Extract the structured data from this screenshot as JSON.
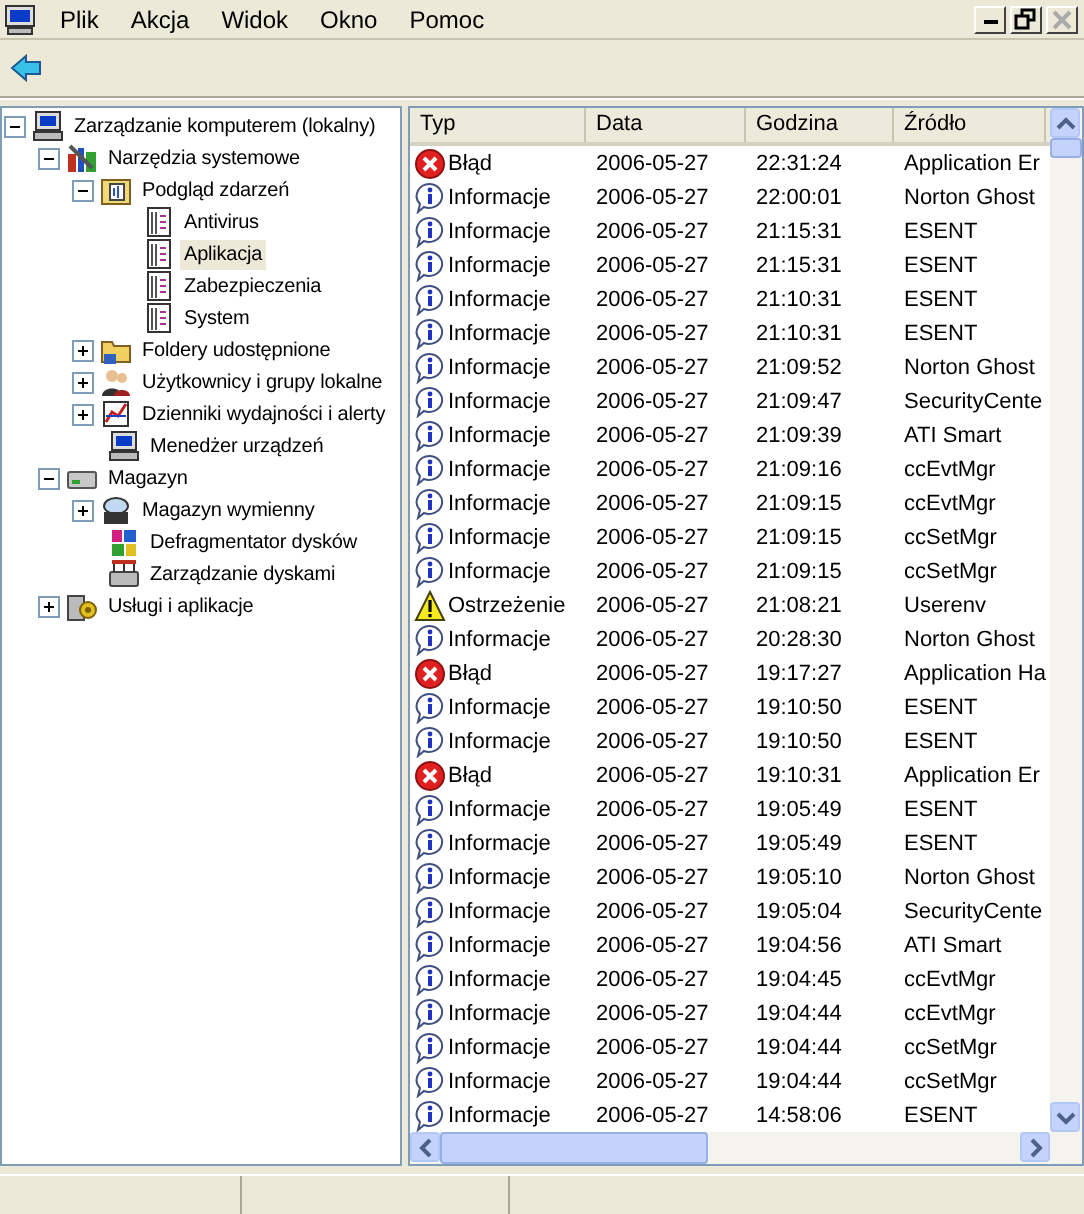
{
  "menu": [
    "Plik",
    "Akcja",
    "Widok",
    "Okno",
    "Pomoc"
  ],
  "tree": [
    {
      "label": "Zarządzanie komputerem (lokalny)",
      "kind": "computer",
      "expanded": true,
      "selected": false,
      "children": [
        {
          "label": "Narzędzia systemowe",
          "kind": "tools",
          "expanded": true,
          "selected": false,
          "children": [
            {
              "label": "Podgląd zdarzeń",
              "kind": "viewer",
              "expanded": true,
              "selected": false,
              "children": [
                {
                  "label": "Antivirus",
                  "kind": "log",
                  "selected": false
                },
                {
                  "label": "Aplikacja",
                  "kind": "log",
                  "selected": true
                },
                {
                  "label": "Zabezpieczenia",
                  "kind": "log",
                  "selected": false
                },
                {
                  "label": "System",
                  "kind": "log",
                  "selected": false
                }
              ]
            },
            {
              "label": "Foldery udostępnione",
              "kind": "folder",
              "expanded": false,
              "selected": false
            },
            {
              "label": "Użytkownicy i grupy lokalne",
              "kind": "users",
              "expanded": false,
              "selected": false
            },
            {
              "label": "Dzienniki wydajności i alerty",
              "kind": "chart",
              "expanded": false,
              "selected": false
            },
            {
              "label": "Menedżer urządzeń",
              "kind": "computer",
              "selected": false
            }
          ]
        },
        {
          "label": "Magazyn",
          "kind": "drive",
          "expanded": true,
          "selected": false,
          "children": [
            {
              "label": "Magazyn wymienny",
              "kind": "disc",
              "expanded": false,
              "selected": false
            },
            {
              "label": "Defragmentator dysków",
              "kind": "defrag",
              "selected": false
            },
            {
              "label": "Zarządzanie dyskami",
              "kind": "disk",
              "selected": false
            }
          ]
        },
        {
          "label": "Usługi i aplikacje",
          "kind": "services",
          "expanded": false,
          "selected": false
        }
      ]
    }
  ],
  "table": {
    "columns": [
      "Typ",
      "Data",
      "Godzina",
      "Źródło"
    ],
    "rows": [
      {
        "kind": "error",
        "type": "Błąd",
        "date": "2006-05-27",
        "time": "22:31:24",
        "source": "Application Er"
      },
      {
        "kind": "info",
        "type": "Informacje",
        "date": "2006-05-27",
        "time": "22:00:01",
        "source": "Norton Ghost"
      },
      {
        "kind": "info",
        "type": "Informacje",
        "date": "2006-05-27",
        "time": "21:15:31",
        "source": "ESENT"
      },
      {
        "kind": "info",
        "type": "Informacje",
        "date": "2006-05-27",
        "time": "21:15:31",
        "source": "ESENT"
      },
      {
        "kind": "info",
        "type": "Informacje",
        "date": "2006-05-27",
        "time": "21:10:31",
        "source": "ESENT"
      },
      {
        "kind": "info",
        "type": "Informacje",
        "date": "2006-05-27",
        "time": "21:10:31",
        "source": "ESENT"
      },
      {
        "kind": "info",
        "type": "Informacje",
        "date": "2006-05-27",
        "time": "21:09:52",
        "source": "Norton Ghost"
      },
      {
        "kind": "info",
        "type": "Informacje",
        "date": "2006-05-27",
        "time": "21:09:47",
        "source": "SecurityCente"
      },
      {
        "kind": "info",
        "type": "Informacje",
        "date": "2006-05-27",
        "time": "21:09:39",
        "source": "ATI Smart"
      },
      {
        "kind": "info",
        "type": "Informacje",
        "date": "2006-05-27",
        "time": "21:09:16",
        "source": "ccEvtMgr"
      },
      {
        "kind": "info",
        "type": "Informacje",
        "date": "2006-05-27",
        "time": "21:09:15",
        "source": "ccEvtMgr"
      },
      {
        "kind": "info",
        "type": "Informacje",
        "date": "2006-05-27",
        "time": "21:09:15",
        "source": "ccSetMgr"
      },
      {
        "kind": "info",
        "type": "Informacje",
        "date": "2006-05-27",
        "time": "21:09:15",
        "source": "ccSetMgr"
      },
      {
        "kind": "warning",
        "type": "Ostrzeżenie",
        "date": "2006-05-27",
        "time": "21:08:21",
        "source": "Userenv"
      },
      {
        "kind": "info",
        "type": "Informacje",
        "date": "2006-05-27",
        "time": "20:28:30",
        "source": "Norton Ghost"
      },
      {
        "kind": "error",
        "type": "Błąd",
        "date": "2006-05-27",
        "time": "19:17:27",
        "source": "Application Ha"
      },
      {
        "kind": "info",
        "type": "Informacje",
        "date": "2006-05-27",
        "time": "19:10:50",
        "source": "ESENT"
      },
      {
        "kind": "info",
        "type": "Informacje",
        "date": "2006-05-27",
        "time": "19:10:50",
        "source": "ESENT"
      },
      {
        "kind": "error",
        "type": "Błąd",
        "date": "2006-05-27",
        "time": "19:10:31",
        "source": "Application Er"
      },
      {
        "kind": "info",
        "type": "Informacje",
        "date": "2006-05-27",
        "time": "19:05:49",
        "source": "ESENT"
      },
      {
        "kind": "info",
        "type": "Informacje",
        "date": "2006-05-27",
        "time": "19:05:49",
        "source": "ESENT"
      },
      {
        "kind": "info",
        "type": "Informacje",
        "date": "2006-05-27",
        "time": "19:05:10",
        "source": "Norton Ghost"
      },
      {
        "kind": "info",
        "type": "Informacje",
        "date": "2006-05-27",
        "time": "19:05:04",
        "source": "SecurityCente"
      },
      {
        "kind": "info",
        "type": "Informacje",
        "date": "2006-05-27",
        "time": "19:04:56",
        "source": "ATI Smart"
      },
      {
        "kind": "info",
        "type": "Informacje",
        "date": "2006-05-27",
        "time": "19:04:45",
        "source": "ccEvtMgr"
      },
      {
        "kind": "info",
        "type": "Informacje",
        "date": "2006-05-27",
        "time": "19:04:44",
        "source": "ccEvtMgr"
      },
      {
        "kind": "info",
        "type": "Informacje",
        "date": "2006-05-27",
        "time": "19:04:44",
        "source": "ccSetMgr"
      },
      {
        "kind": "info",
        "type": "Informacje",
        "date": "2006-05-27",
        "time": "19:04:44",
        "source": "ccSetMgr"
      },
      {
        "kind": "info",
        "type": "Informacje",
        "date": "2006-05-27",
        "time": "14:58:06",
        "source": "ESENT"
      }
    ]
  }
}
